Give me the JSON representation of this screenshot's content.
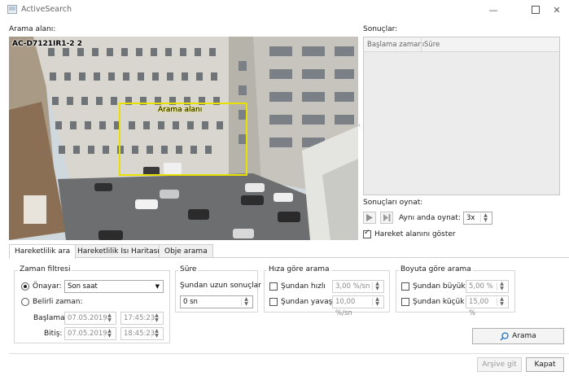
{
  "window": {
    "title": "ActiveSearch"
  },
  "search_area": {
    "label": "Arama alanı:",
    "camera_label": "AC-D7121IR1-2 2",
    "region_label": "Arama alanı"
  },
  "results": {
    "label": "Sonuçlar:",
    "columns": [
      "Başlama zamanı",
      "Süre"
    ]
  },
  "playback": {
    "label": "Sonuçları oynat:",
    "simultaneous_label": "Aynı anda oynat:",
    "simultaneous_value": "3x",
    "show_motion_label": "Hareket alanını göster",
    "show_motion_checked": true
  },
  "tabs": [
    "Hareketlilik ara",
    "Hareketlilik Isı Haritası",
    "Obje arama"
  ],
  "time_filter": {
    "title": "Zaman filtresi",
    "preset_label": "Önayar:",
    "preset_value": "Son saat",
    "custom_label": "Belirli zaman:",
    "start_label": "Başlama:",
    "start_date": "07.05.2019",
    "start_time": "17:45:23",
    "end_label": "Bitiş:",
    "end_date": "07.05.2019",
    "end_time": "18:45:23"
  },
  "duration": {
    "title": "Süre",
    "longer_label": "Şundan uzun sonuçlar",
    "longer_value": "0 sn"
  },
  "speed": {
    "title": "Hıza göre arama",
    "faster_label": "Şundan hızlı",
    "faster_value": "3,00 %/sn",
    "slower_label": "Şundan yavaş",
    "slower_value": "10,00 %/sn"
  },
  "size": {
    "title": "Boyuta göre arama",
    "larger_label": "Şundan büyük",
    "larger_value": "5,00 %",
    "smaller_label": "Şundan küçük",
    "smaller_value": "15,00 %"
  },
  "buttons": {
    "search": "Arama",
    "archive": "Arşive git",
    "close": "Kapat"
  },
  "colors": {
    "region": "#e8e000",
    "accent": "#1a73c8"
  }
}
